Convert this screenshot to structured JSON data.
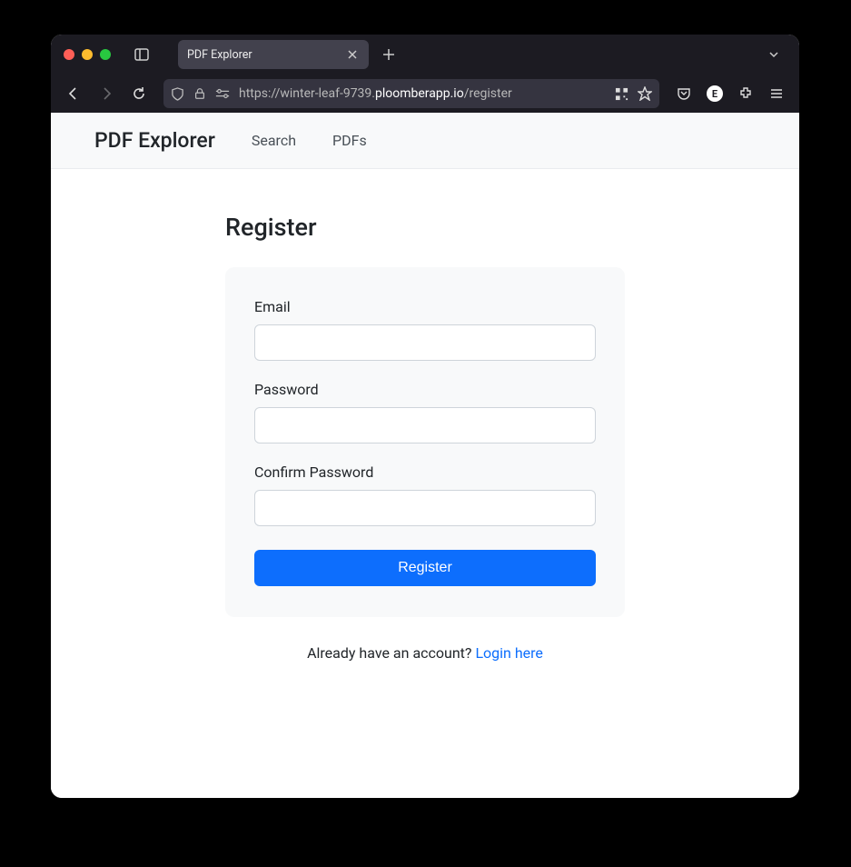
{
  "browser": {
    "tab_title": "PDF Explorer",
    "url_prefix": "https://winter-leaf-9739.",
    "url_domain": "ploomberapp.io",
    "url_path": "/register"
  },
  "nav": {
    "brand": "PDF Explorer",
    "links": [
      "Search",
      "PDFs"
    ]
  },
  "page": {
    "title": "Register",
    "fields": {
      "email_label": "Email",
      "password_label": "Password",
      "confirm_label": "Confirm Password"
    },
    "submit_label": "Register",
    "login_prompt": "Already have an account? ",
    "login_link": "Login here"
  }
}
